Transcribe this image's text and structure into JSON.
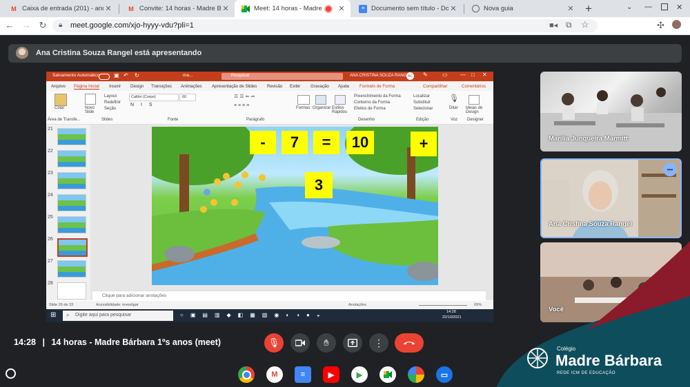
{
  "browser": {
    "tabs": [
      {
        "title": "Caixa de entrada (201) - andre",
        "icon": "gmail-icon",
        "active": false
      },
      {
        "title": "Convite: 14 horas - Madre Bárbara",
        "icon": "gmail-icon",
        "active": false
      },
      {
        "title": "Meet: 14 horas - Madre Bárbara",
        "icon": "meet-icon",
        "active": true,
        "recording": true
      },
      {
        "title": "Documento sem título - Docum",
        "icon": "docs-icon",
        "active": false
      },
      {
        "title": "Nova guia",
        "icon": "chrome-icon",
        "active": false
      }
    ],
    "new_tab": "+",
    "url": "meet.google.com/xjo-hyyy-vdu?pli=1"
  },
  "meet": {
    "presenting_banner": "Ana Cristina Souza Rangel está apresentando",
    "time": "14:28",
    "divider": "|",
    "meeting_name": "14 horas - Madre Bárbara 1ºs anos (meet)",
    "participants": [
      {
        "name": "Marilia Junqueira Marmitt"
      },
      {
        "name": "Ana Cristina Souza Rangel",
        "more": "•••"
      },
      {
        "name": "Você"
      }
    ]
  },
  "shared_screen": {
    "ppt_title_bar": {
      "autosave": "Salvamento Automático",
      "filename": "ma...",
      "search": "Pesquisar",
      "user": "ANA CRISTINA SOUZA RANGEL",
      "user_initials": "AC"
    },
    "ribbon_tabs": [
      "Arquivo",
      "Página Inicial",
      "Inserir",
      "Design",
      "Transições",
      "Animações",
      "Apresentação de Slides",
      "Revisão",
      "Exibir",
      "Gravação",
      "Ajuda",
      "Formato de Forma"
    ],
    "share_btn": "Compartilhar",
    "comments_btn": "Comentários",
    "ribbon_groups": [
      "Área de Transfe...",
      "Slides",
      "Fonte",
      "Parágrafo",
      "Desenho",
      "Edição",
      "Voz",
      "Designer"
    ],
    "ribbon_items": {
      "paste": "Colar",
      "new_slide": "Novo Slide",
      "layout": "Layout",
      "reset": "Redefinir",
      "section": "Seção",
      "font": "Calibri (Corpo)",
      "font_size": "60",
      "shapes": "Formas",
      "arrange": "Organizar",
      "quick_styles": "Estilos Rápidos",
      "fill": "Preenchimento da Forma",
      "outline": "Contorno da Forma",
      "effects": "Efeitos de Forma",
      "find": "Localizar",
      "replace": "Substituir",
      "select": "Selecionar",
      "dictate": "Ditar",
      "designer_ideas": "Ideias de Design"
    },
    "slide_thumbs": [
      "21",
      "22",
      "23",
      "24",
      "25",
      "26",
      "27",
      "28"
    ],
    "slide": {
      "cards": [
        "-",
        "7",
        "=",
        "10",
        "+",
        "3"
      ]
    },
    "notes_placeholder": "Clique para adicionar anotações",
    "status": {
      "slide_count": "Slide 26 de 33",
      "accessibility": "Acessibilidade: investigar",
      "notes_btn": "Anotações",
      "zoom": "69%"
    },
    "taskbar": {
      "search": "Digite aqui para pesquisar",
      "time": "14:28",
      "date": "22/10/2021"
    }
  },
  "controls": {
    "mic": "mic-off-icon",
    "camera": "camera-icon",
    "hand": "raise-hand-icon",
    "present": "present-icon",
    "more": "more-icon",
    "end": "end-call-icon"
  },
  "logo": {
    "pre": "Colégio",
    "name": "Madre Bárbara",
    "sub": "REDE ICM DE EDUCAÇÃO"
  },
  "shelf_apps": [
    "chrome-icon",
    "gmail-icon",
    "docs-icon",
    "youtube-icon",
    "play-store-icon",
    "meet-icon",
    "photos-icon",
    "messages-icon"
  ],
  "colors": {
    "end_call": "#ea4335",
    "mic_off": "#ea4335",
    "logo_bg": "#0e4d5c",
    "logo_accent": "#8b1a2b",
    "ppt_orange": "#c43e1c"
  }
}
